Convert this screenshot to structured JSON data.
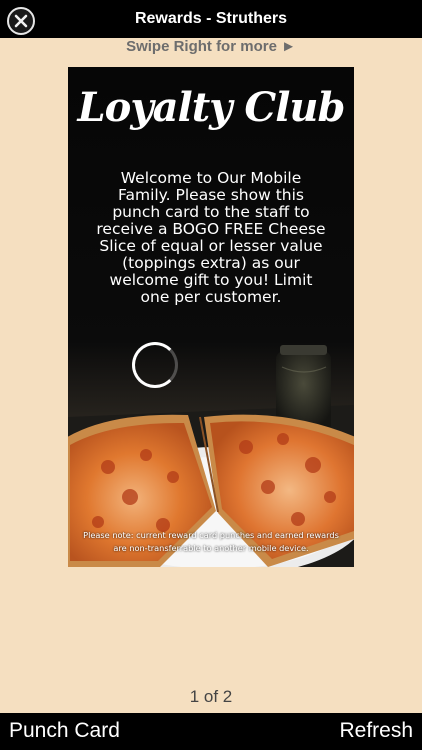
{
  "topbar": {
    "title": "Rewards - Struthers",
    "close_icon": "close-icon"
  },
  "swipe_hint": "Swipe Right for more ►",
  "card": {
    "title": "Loyalty Club",
    "message": "Welcome to Our Mobile Family. Please show this punch card to the staff to receive a BOGO FREE Cheese Slice of equal or lesser value (toppings extra) as our welcome gift to you! Limit one per customer.",
    "footnote": "Please note: current reward card punches and earned rewards are non-transferrable to another mobile device.",
    "image": "pizza-slices-photo"
  },
  "pagination": {
    "label": "1 of 2"
  },
  "bottombar": {
    "left_label": "Punch Card",
    "right_label": "Refresh"
  },
  "colors": {
    "background": "#f5dfc0",
    "bars": "#000000",
    "hint_text": "#6d6d6d"
  }
}
